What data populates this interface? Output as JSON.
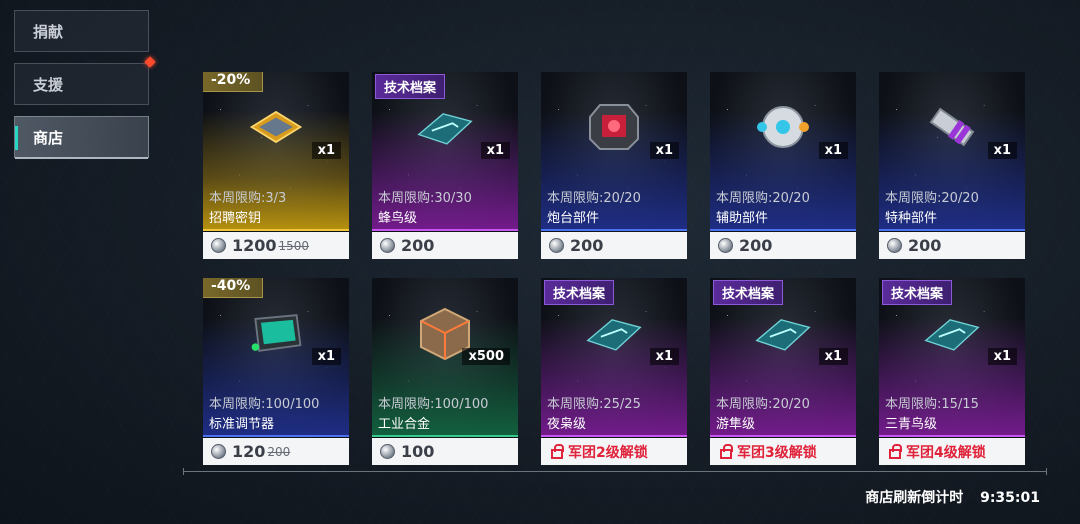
{
  "nav": {
    "items": [
      {
        "label": "捐献",
        "active": false
      },
      {
        "label": "支援",
        "active": false,
        "alert": true
      },
      {
        "label": "商店",
        "active": true
      }
    ]
  },
  "shop": {
    "items": [
      {
        "badge_discount": "-20%",
        "quantity": "x1",
        "limit": "本周限购:3/3",
        "name": "招聘密钥",
        "price": "1200",
        "old_price": "1500",
        "rarity": "gold",
        "icon": "key-crate-icon"
      },
      {
        "badge_tech": "技术档案",
        "quantity": "x1",
        "limit": "本周限购:30/30",
        "name": "蜂鸟级",
        "price": "200",
        "rarity": "purple",
        "icon": "blueprint-icon"
      },
      {
        "quantity": "x1",
        "limit": "本周限购:20/20",
        "name": "炮台部件",
        "price": "200",
        "rarity": "blue",
        "icon": "turret-part-icon"
      },
      {
        "quantity": "x1",
        "limit": "本周限购:20/20",
        "name": "辅助部件",
        "price": "200",
        "rarity": "blue",
        "icon": "support-part-icon"
      },
      {
        "quantity": "x1",
        "limit": "本周限购:20/20",
        "name": "特种部件",
        "price": "200",
        "rarity": "blue",
        "icon": "special-part-icon"
      },
      {
        "badge_discount": "-40%",
        "quantity": "x1",
        "limit": "本周限购:100/100",
        "name": "标准调节器",
        "price": "120",
        "old_price": "200",
        "rarity": "blue",
        "icon": "regulator-icon"
      },
      {
        "quantity": "x500",
        "limit": "本周限购:100/100",
        "name": "工业合金",
        "price": "100",
        "rarity": "green",
        "icon": "alloy-icon"
      },
      {
        "badge_tech": "技术档案",
        "quantity": "x1",
        "limit": "本周限购:25/25",
        "name": "夜枭级",
        "locked": "军团2级解锁",
        "rarity": "purple",
        "icon": "blueprint-icon"
      },
      {
        "badge_tech": "技术档案",
        "quantity": "x1",
        "limit": "本周限购:20/20",
        "name": "游隼级",
        "locked": "军团3级解锁",
        "rarity": "purple",
        "icon": "blueprint-icon"
      },
      {
        "badge_tech": "技术档案",
        "quantity": "x1",
        "limit": "本周限购:15/15",
        "name": "三青鸟级",
        "locked": "军团4级解锁",
        "rarity": "purple",
        "icon": "blueprint-icon"
      }
    ]
  },
  "footer": {
    "refresh_label": "商店刷新倒计时",
    "countdown": "9:35:01"
  },
  "colors": {
    "gold": "#b8920e",
    "purple": "#741b8c",
    "blue": "#1f2d86",
    "green": "#12613f",
    "locked_text": "#e0223a",
    "active_accent": "#26d8c4"
  }
}
